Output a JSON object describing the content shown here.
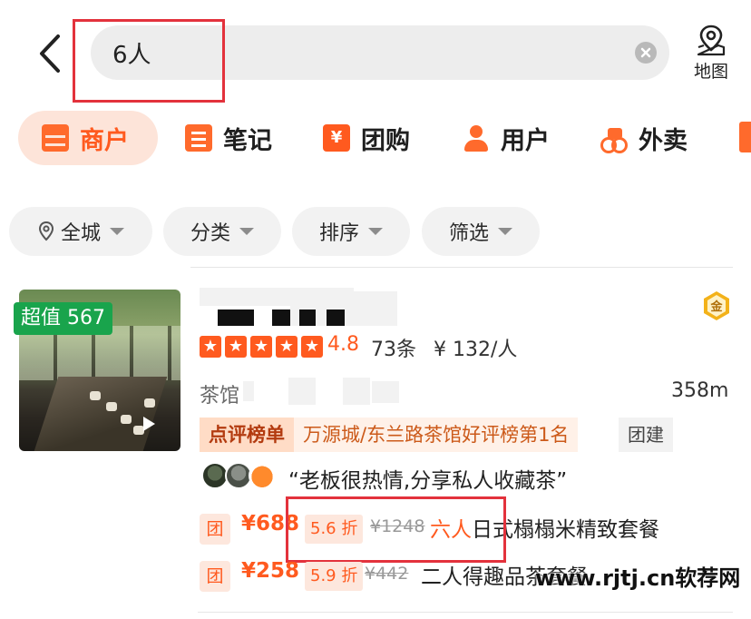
{
  "search": {
    "query": "6人",
    "map_label": "地图"
  },
  "tabs": [
    {
      "label": "商户",
      "icon": "store-icon"
    },
    {
      "label": "笔记",
      "icon": "note-icon"
    },
    {
      "label": "团购",
      "icon": "group-buy-icon",
      "glyph": "¥"
    },
    {
      "label": "用户",
      "icon": "user-icon"
    },
    {
      "label": "外卖",
      "icon": "delivery-icon"
    }
  ],
  "filters": [
    {
      "label": "全城"
    },
    {
      "label": "分类"
    },
    {
      "label": "排序"
    },
    {
      "label": "筛选"
    }
  ],
  "listing": {
    "promo_badge": "超值 567",
    "gold_badge": "金",
    "rating_stars": 5,
    "rating": "4.8",
    "reviews": "73条",
    "price": "¥ 132/人",
    "category": "茶馆",
    "distance": "358m",
    "rank_label": "点评榜单",
    "rank_text": "万源城/东兰路茶馆好评榜第1名",
    "tag": "团建",
    "quote": "“老板很热情,分享私人收藏茶”",
    "deals": [
      {
        "tuan": "团",
        "price": "¥688",
        "discount": "5.6 折",
        "original": "¥1248",
        "title_highlight": "六人",
        "title_rest": "日式榻榻米精致套餐"
      },
      {
        "tuan": "团",
        "price": "¥258",
        "discount": "5.9 折",
        "original": "¥442",
        "title_highlight": "",
        "title_rest": "二人得趣品茶套餐"
      }
    ]
  },
  "watermark": "www.rjtj.cn软荐网",
  "colors": {
    "accent": "#ff5a1f",
    "highlight_box": "#e3323c",
    "promo_green": "#19a44c"
  }
}
